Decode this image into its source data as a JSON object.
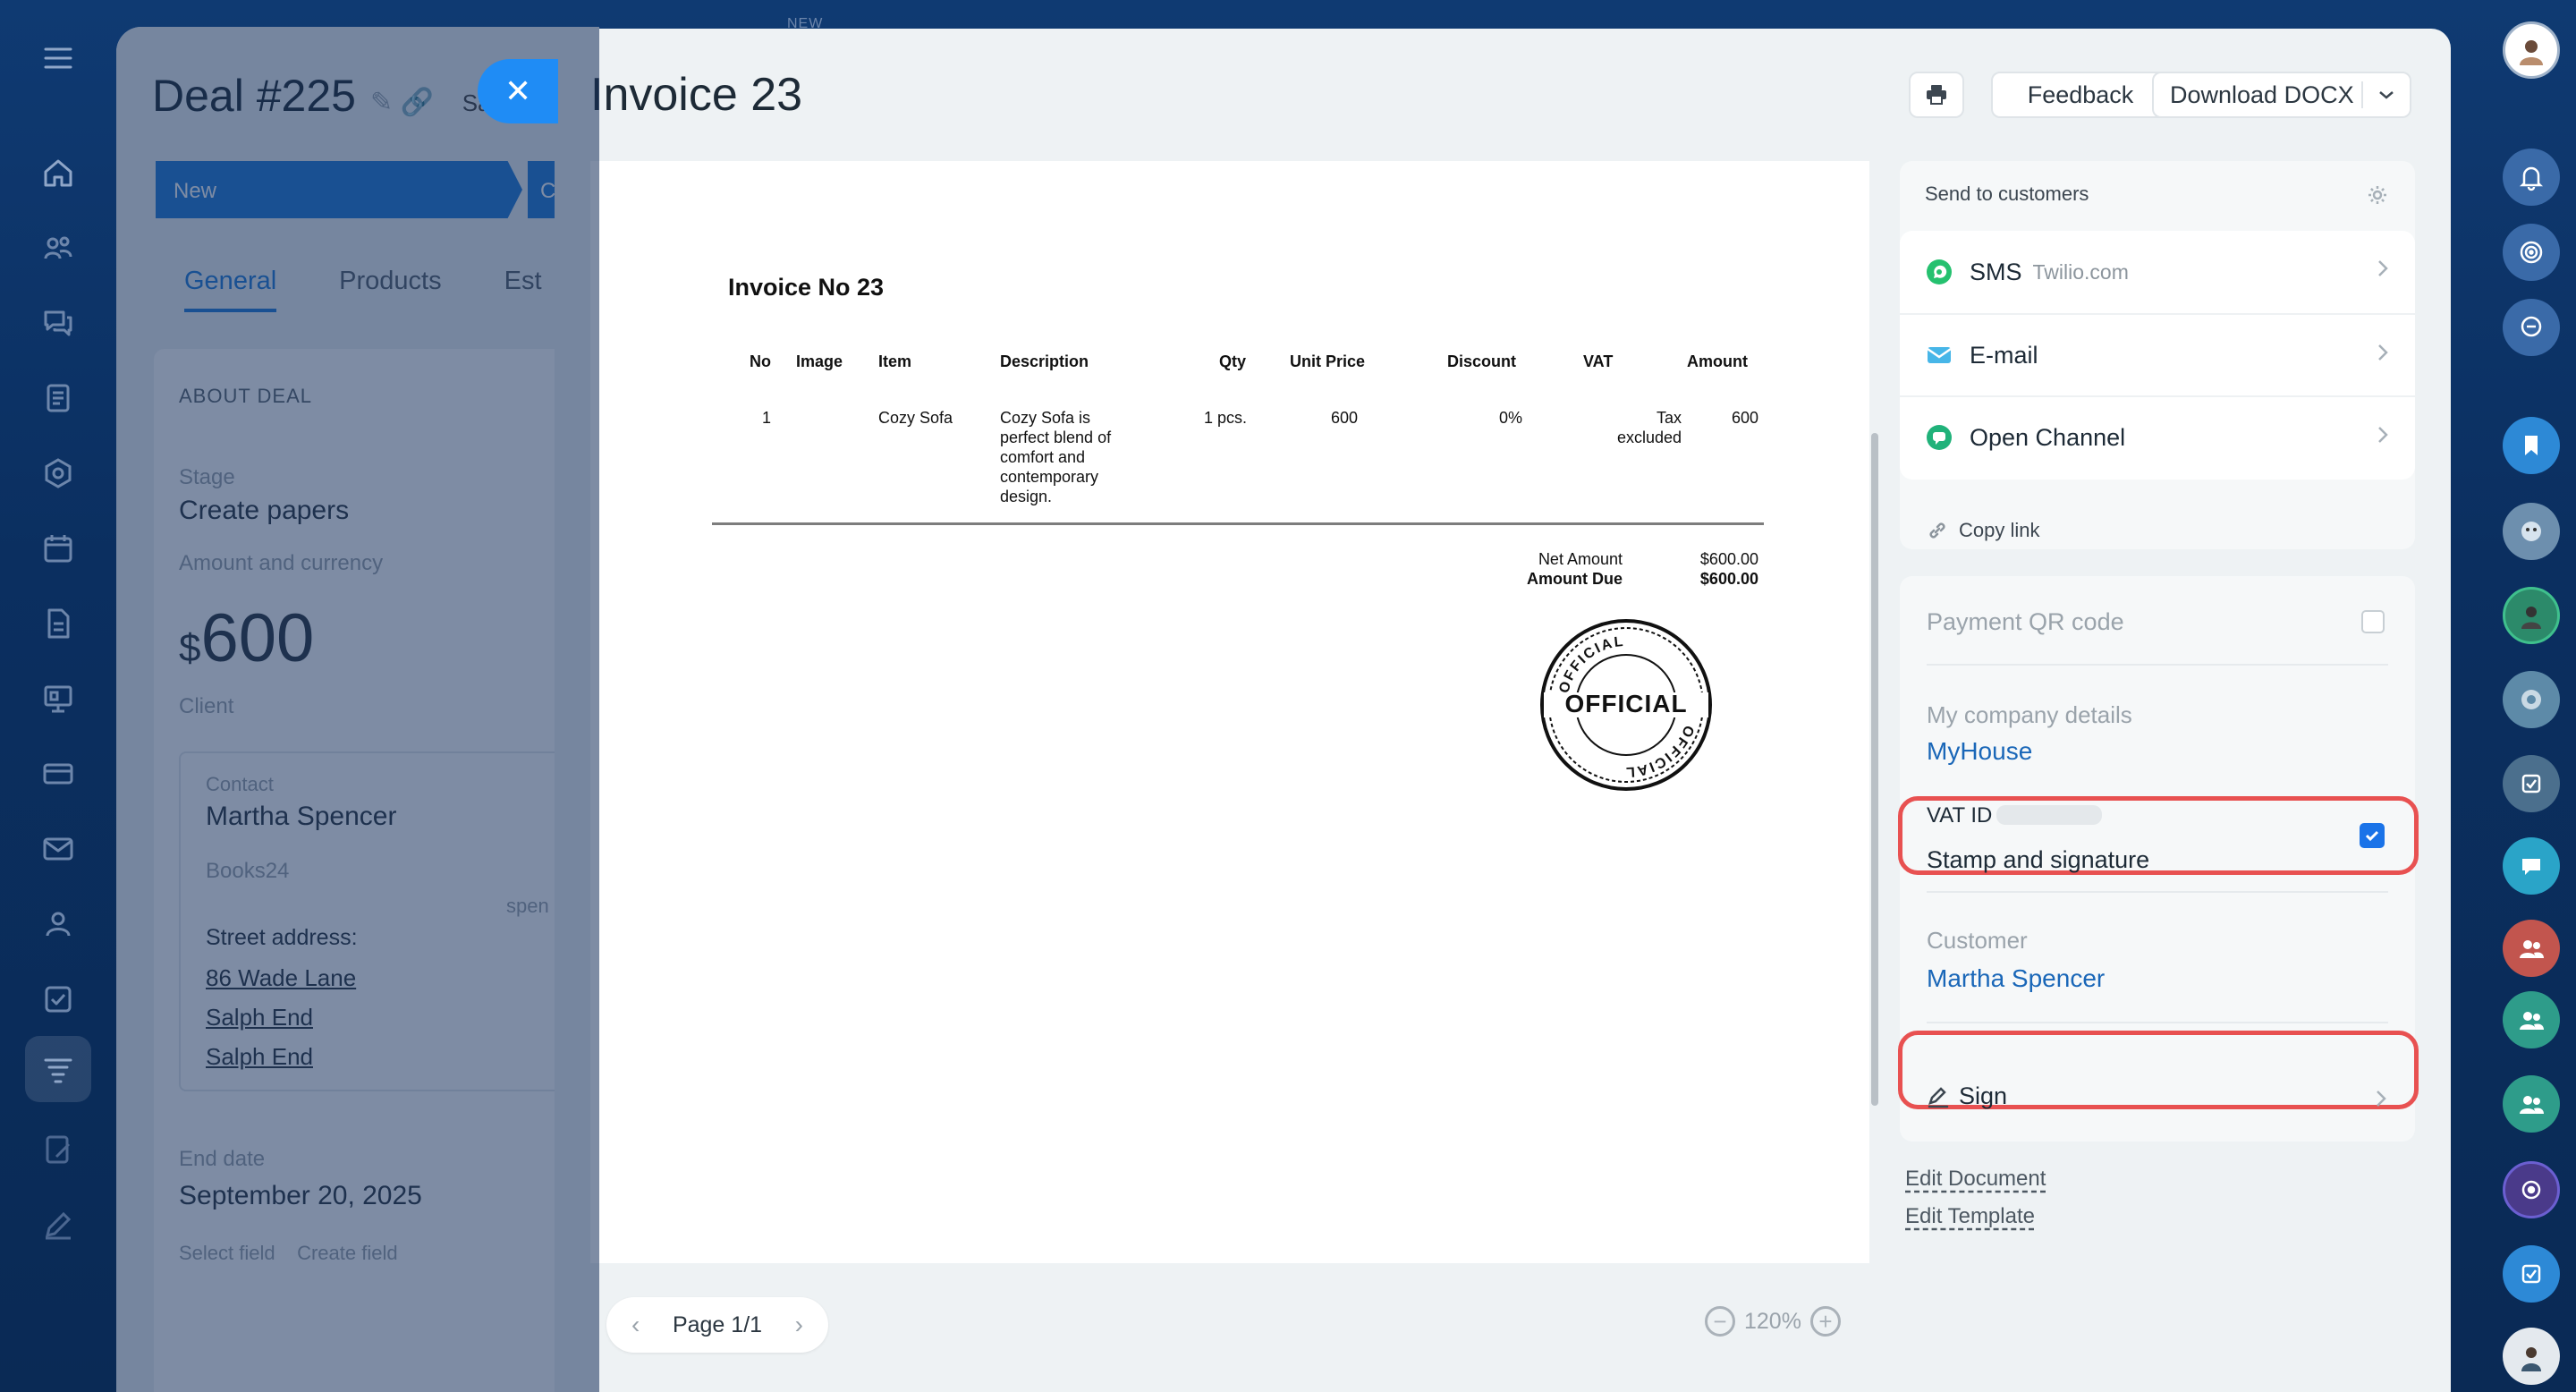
{
  "deal": {
    "title": "Deal #225",
    "title_suffix": "Sa",
    "stage_label": "New",
    "stage_next_initial": "C",
    "tabs": [
      "General",
      "Products",
      "Est"
    ],
    "section_title": "ABOUT DEAL",
    "stage_field_label": "Stage",
    "stage_value": "Create papers",
    "amount_label": "Amount and currency",
    "amount_currency": "$",
    "amount_value": "600",
    "client_label": "Client",
    "contact_label": "Contact",
    "contact_name": "Martha Spencer",
    "company": "Books24",
    "contact_fragment": "spen",
    "street_label": "Street address:",
    "address_lines": [
      "86 Wade Lane",
      "Salph End",
      "Salph End"
    ],
    "end_date_label": "End date",
    "end_date_value": "September 20, 2025",
    "footer_actions": "Select field    Create field"
  },
  "header": {
    "new_badge": "NEW",
    "title": "Invoice 23",
    "feedback_label": "Feedback",
    "download_label": "Download DOCX"
  },
  "document": {
    "title": "Invoice No 23",
    "columns": [
      "No",
      "Image",
      "Item",
      "Description",
      "Qty",
      "Unit Price",
      "Discount",
      "VAT",
      "Amount"
    ],
    "row": {
      "no": "1",
      "item": "Cozy Sofa",
      "description_lines": [
        "Cozy Sofa is",
        "perfect blend of",
        "comfort and",
        "contemporary",
        "design."
      ],
      "qty": "1 pcs.",
      "unit_price": "600",
      "discount": "0%",
      "vat_lines": [
        "Tax",
        "excluded"
      ],
      "amount": "600"
    },
    "net_amount_label": "Net Amount",
    "net_amount_value": "$600.00",
    "amount_due_label": "Amount Due",
    "amount_due_value": "$600.00",
    "stamp_text": "OFFICIAL"
  },
  "pager": {
    "label": "Page 1/1"
  },
  "zoom": {
    "level": "120%"
  },
  "send": {
    "title": "Send to customers",
    "channels": [
      {
        "name": "SMS",
        "sub": "Twilio.com",
        "icon": "whatsapp-icon"
      },
      {
        "name": "E-mail",
        "sub": "",
        "icon": "mail-icon"
      },
      {
        "name": "Open Channel",
        "sub": "",
        "icon": "chat-icon"
      }
    ],
    "copy_link_label": "Copy link"
  },
  "options": {
    "payment_qr_label": "Payment QR code",
    "payment_qr_checked": false,
    "company_label": "My company details",
    "company_value": "MyHouse",
    "vat_id_label": "VAT ID",
    "stamp_label": "Stamp and signature",
    "stamp_checked": true,
    "customer_label": "Customer",
    "customer_value": "Martha Spencer",
    "sign_label": "Sign"
  },
  "links": {
    "edit_document": "Edit Document",
    "edit_template": "Edit Template"
  },
  "colors": {
    "accent": "#1a73e8",
    "highlight": "#e85151",
    "link": "#1a67b8"
  }
}
